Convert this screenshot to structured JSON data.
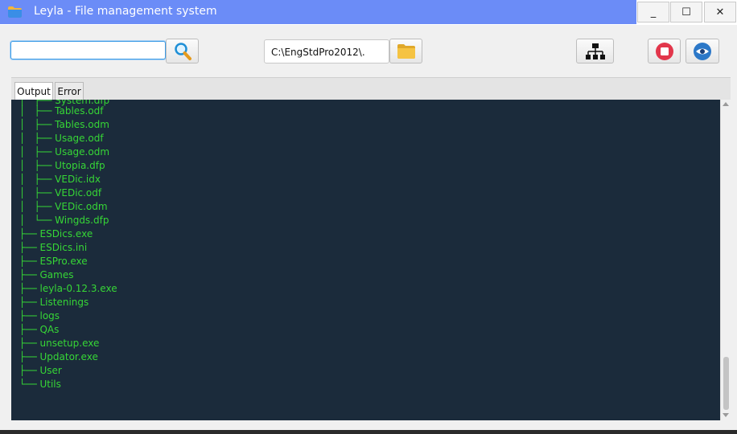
{
  "window": {
    "title": "Leyla - File management system",
    "controls": {
      "minimize": "_",
      "maximize": "☐",
      "close": "✕"
    },
    "accent_color": "#6b8cf7"
  },
  "toolbar": {
    "search": {
      "value": "",
      "placeholder": "",
      "button_icon": "search-icon"
    },
    "path": {
      "value": "C:\\EngStdPro2012\\.",
      "button_icon": "folder-icon"
    },
    "tree_button_icon": "hierarchy-icon",
    "stop_button_icon": "stop-icon",
    "view_button_icon": "eye-icon"
  },
  "tabs": [
    {
      "label": "Output",
      "active": true
    },
    {
      "label": "Error",
      "active": false
    }
  ],
  "console": {
    "text_color": "#36d636",
    "background": "#1b2b3b",
    "lines": [
      "│   ├── System.dfp",
      "│   ├── Tables.odf",
      "│   ├── Tables.odm",
      "│   ├── Usage.odf",
      "│   ├── Usage.odm",
      "│   ├── Utopia.dfp",
      "│   ├── VEDic.idx",
      "│   ├── VEDic.odf",
      "│   ├── VEDic.odm",
      "│   └── Wingds.dfp",
      "├── ESDics.exe",
      "├── ESDics.ini",
      "├── ESPro.exe",
      "├── Games",
      "├── leyla-0.12.3.exe",
      "├── Listenings",
      "├── logs",
      "├── QAs",
      "├── unsetup.exe",
      "├── Updator.exe",
      "├── User",
      "└── Utils"
    ]
  }
}
